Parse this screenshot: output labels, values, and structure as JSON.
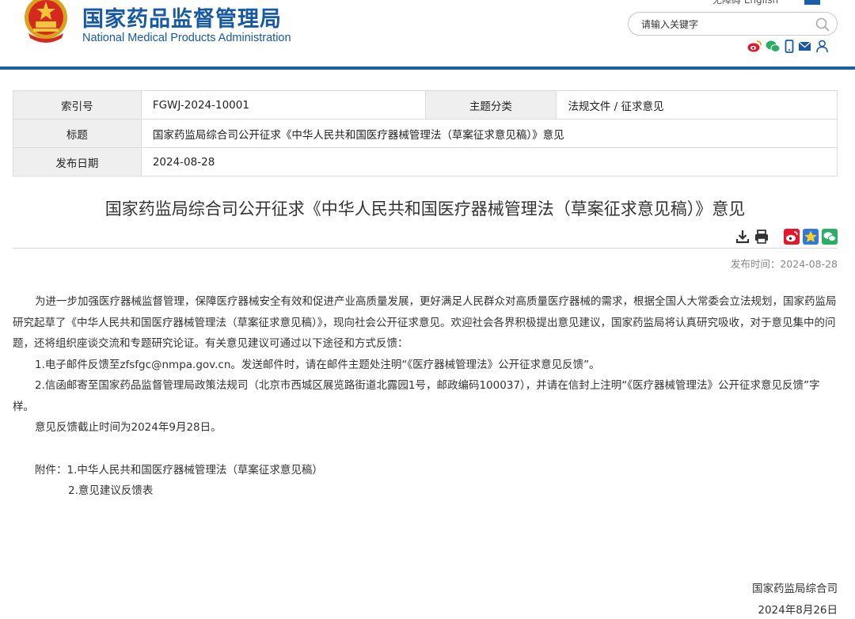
{
  "header": {
    "site_name_cn": "国家药品监督管理局",
    "site_name_en": "National Medical Products Administration",
    "topnav_partial": "无障碍  English",
    "search": {
      "placeholder": "请输入关键字"
    },
    "brand_color": "#1759a5",
    "social_icons": [
      "weibo-icon",
      "wechat-icon",
      "mobile-icon",
      "mail-icon",
      "user-icon"
    ]
  },
  "info_table": {
    "index_label": "索引号",
    "index_value": "FGWJ-2024-10001",
    "category_label": "主题分类",
    "category_value": "法规文件 / 征求意见",
    "title_label": "标题",
    "title_value": "国家药监局综合司公开征求《中华人民共和国医疗器械管理法（草案征求意见稿）》意见",
    "date_label": "发布日期",
    "date_value": "2024-08-28"
  },
  "article": {
    "title": "国家药监局综合司公开征求《中华人民共和国医疗器械管理法（草案征求意见稿）》意见",
    "publish_time": "发布时间：2024-08-28",
    "tool_icons": [
      "download-icon",
      "print-icon",
      "weibo-share-icon",
      "favorite-icon",
      "wechat-share-icon"
    ],
    "paragraphs": [
      "为进一步加强医疗器械监督管理，保障医疗器械安全有效和促进产业高质量发展，更好满足人民群众对高质量医疗器械的需求，根据全国人大常委会立法规划，国家药监局研究起草了《中华人民共和国医疗器械管理法（草案征求意见稿）》，现向社会公开征求意见。欢迎社会各界积极提出意见建议，国家药监局将认真研究吸收，对于意见集中的问题，还将组织座谈交流和专题研究论证。有关意见建议可通过以下途径和方式反馈：",
      "1.电子邮件反馈至zfsfgc@nmpa.gov.cn。发送邮件时，请在邮件主题处注明“《医疗器械管理法》公开征求意见反馈”。",
      "2.信函邮寄至国家药品监督管理局政策法规司（北京市西城区展览路街道北露园1号，邮政编码100037），并请在信封上注明“《医疗器械管理法》公开征求意见反馈”字样。",
      "意见反馈截止时间为2024年9月28日。"
    ],
    "attachments": [
      "附件：1.中华人民共和国医疗器械管理法（草案征求意见稿）",
      "2.意见建议反馈表"
    ],
    "signature_org": "国家药监局综合司",
    "signature_date": "2024年8月26日"
  }
}
